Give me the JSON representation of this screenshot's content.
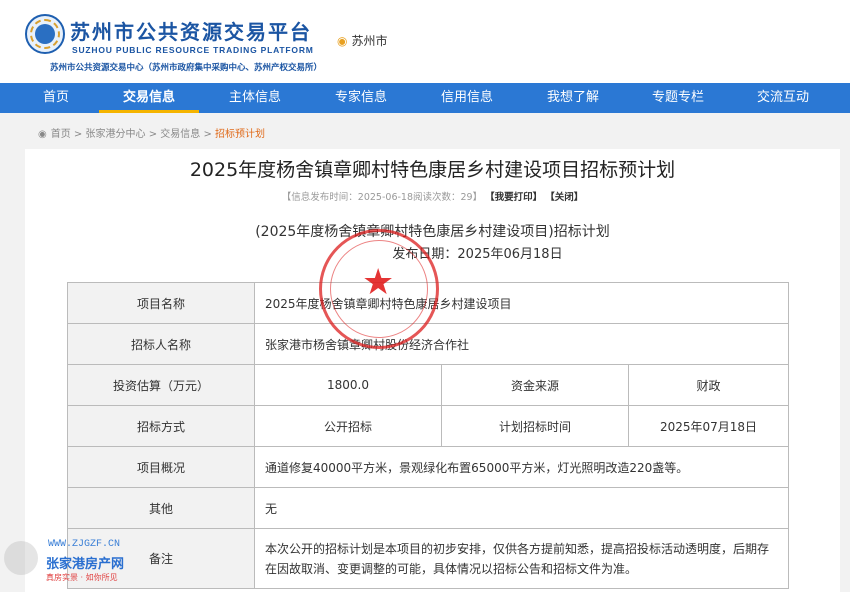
{
  "header": {
    "title": "苏州市公共资源交易平台",
    "title_en": "SUZHOU PUBLIC RESOURCE TRADING PLATFORM",
    "subtitle": "苏州市公共资源交易中心（苏州市政府集中采购中心、苏州产权交易所）",
    "location": "苏州市"
  },
  "nav": {
    "items": [
      {
        "label": "首页"
      },
      {
        "label": "交易信息"
      },
      {
        "label": "主体信息"
      },
      {
        "label": "专家信息"
      },
      {
        "label": "信用信息"
      },
      {
        "label": "我想了解"
      },
      {
        "label": "专题专栏"
      },
      {
        "label": "交流互动"
      }
    ],
    "active": "交易信息"
  },
  "breadcrumb": {
    "items": [
      "首页",
      "张家港分中心",
      "交易信息",
      "招标预计划"
    ],
    "separator": ">"
  },
  "article": {
    "title": "2025年度杨舍镇章卿村特色康居乡村建设项目招标预计划",
    "meta_publish": "【信息发布时间：2025-06-18阅读次数：29】",
    "print_label": "【我要打印】",
    "close_label": "【关闭】",
    "sub_title": "(2025年度杨舍镇章卿村特色康居乡村建设项目)招标计划",
    "date_line": "发布日期：2025年06月18日"
  },
  "table": {
    "project_name_label": "项目名称",
    "project_name": "2025年度杨舍镇章卿村特色康居乡村建设项目",
    "tenderer_label": "招标人名称",
    "tenderer": "张家港市杨舍镇章卿村股份经济合作社",
    "investment_label": "投资估算（万元）",
    "investment": "1800.0",
    "fund_source_label": "资金来源",
    "fund_source": "财政",
    "method_label": "招标方式",
    "method": "公开招标",
    "plan_time_label": "计划招标时间",
    "plan_time": "2025年07月18日",
    "overview_label": "项目概况",
    "overview": "通道修复40000平方米，景观绿化布置65000平方米，灯光照明改造220盏等。",
    "other_label": "其他",
    "other": "无",
    "remark_label": "备注",
    "remark": "本次公开的招标计划是本项目的初步安排，仅供各方提前知悉，提高招投标活动透明度，后期存在因故取消、变更调整的可能，具体情况以招标公告和招标文件为准。"
  },
  "watermark": {
    "url": "WWW.ZJGZF.CN",
    "name": "张家港房产网",
    "slogan": "真房实景 · 如你所见"
  },
  "colors": {
    "nav_bg": "#2b78d4",
    "active_underline": "#f5b400",
    "brand": "#1b55a3",
    "meta_orange": "#e35a28"
  }
}
